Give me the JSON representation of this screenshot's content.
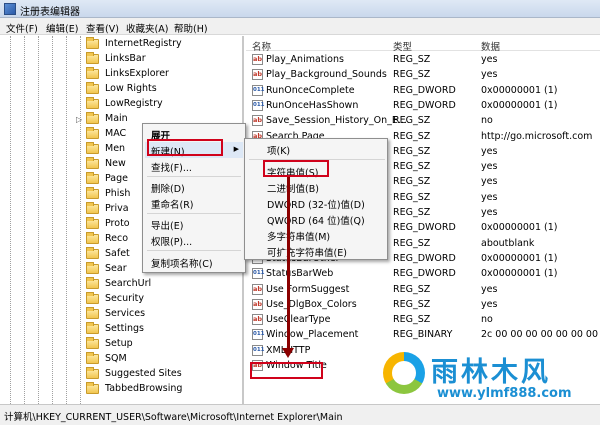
{
  "window": {
    "title": "注册表编辑器"
  },
  "menu": [
    "文件(F)",
    "编辑(E)",
    "查看(V)",
    "收藏夹(A)",
    "帮助(H)"
  ],
  "tree": [
    "InternetRegistry",
    "LinksBar",
    "LinksExplorer",
    "Low Rights",
    "LowRegistry",
    "Main",
    "MAC",
    "Men",
    "New",
    "Page",
    "Phish",
    "Priva",
    "Proto",
    "Reco",
    "Safet",
    "Sear",
    "SearchUrl",
    "Security",
    "Services",
    "Settings",
    "Setup",
    "SQM",
    "Suggested Sites",
    "TabbedBrowsing"
  ],
  "columns": {
    "name": "名称",
    "type": "类型",
    "data": "数据"
  },
  "values": [
    {
      "name": "Play_Animations",
      "type": "REG_SZ",
      "data": "yes",
      "icon": "string"
    },
    {
      "name": "Play_Background_Sounds",
      "type": "REG_SZ",
      "data": "yes",
      "icon": "string"
    },
    {
      "name": "RunOnceComplete",
      "type": "REG_DWORD",
      "data": "0x00000001 (1)",
      "icon": "binary"
    },
    {
      "name": "RunOnceHasShown",
      "type": "REG_DWORD",
      "data": "0x00000001 (1)",
      "icon": "binary"
    },
    {
      "name": "Save_Session_History_On_E...",
      "type": "REG_SZ",
      "data": "no",
      "icon": "string"
    },
    {
      "name": "Search Page",
      "type": "REG_SZ",
      "data": "http://go.microsoft.com",
      "icon": "string"
    },
    {
      "name": "",
      "type": "REG_SZ",
      "data": "yes",
      "icon": "string"
    },
    {
      "name": "",
      "type": "REG_SZ",
      "data": "yes",
      "icon": "string"
    },
    {
      "name": "",
      "type": "REG_SZ",
      "data": "yes",
      "icon": "string"
    },
    {
      "name": "",
      "type": "REG_SZ",
      "data": "yes",
      "icon": "string"
    },
    {
      "name": "",
      "type": "REG_SZ",
      "data": "yes",
      "icon": "string"
    },
    {
      "name": "",
      "type": "REG_DWORD",
      "data": "0x00000001 (1)",
      "icon": "binary"
    },
    {
      "name": "",
      "type": "REG_SZ",
      "data": "aboutblank",
      "icon": "string"
    },
    {
      "name": "StatusBarOther",
      "type": "REG_DWORD",
      "data": "0x00000001 (1)",
      "icon": "binary"
    },
    {
      "name": "StatusBarWeb",
      "type": "REG_DWORD",
      "data": "0x00000001 (1)",
      "icon": "binary"
    },
    {
      "name": "Use FormSuggest",
      "type": "REG_SZ",
      "data": "yes",
      "icon": "string"
    },
    {
      "name": "Use_DlgBox_Colors",
      "type": "REG_SZ",
      "data": "yes",
      "icon": "string"
    },
    {
      "name": "UseClearType",
      "type": "REG_SZ",
      "data": "no",
      "icon": "string"
    },
    {
      "name": "Window_Placement",
      "type": "REG_BINARY",
      "data": "2c 00 00 00 00 00 00 00",
      "icon": "binary"
    },
    {
      "name": "XMLHTTP",
      "type": "",
      "data": "",
      "icon": "binary"
    },
    {
      "name": "Window Title",
      "type": "",
      "data": "",
      "icon": "string"
    }
  ],
  "context_menu": {
    "items": [
      "展开",
      "新建(N)",
      "查找(F)...",
      "删除(D)",
      "重命名(R)",
      "导出(E)",
      "权限(P)...",
      "复制项名称(C)"
    ]
  },
  "submenu": {
    "items": [
      "项(K)",
      "字符串值(S)",
      "二进制值(B)",
      "DWORD (32-位)值(D)",
      "QWORD (64 位)值(Q)",
      "多字符串值(M)",
      "可扩充字符串值(E)"
    ]
  },
  "status": {
    "path": "计算机\\HKEY_CURRENT_USER\\Software\\Microsoft\\Internet Explorer\\Main"
  },
  "watermark": {
    "brand": "雨林木风",
    "url": "www.ylmf888.com"
  },
  "colors": {
    "highlight": "#d0021b",
    "arrow": "#8b0000",
    "brand": "#1b8fd3"
  }
}
